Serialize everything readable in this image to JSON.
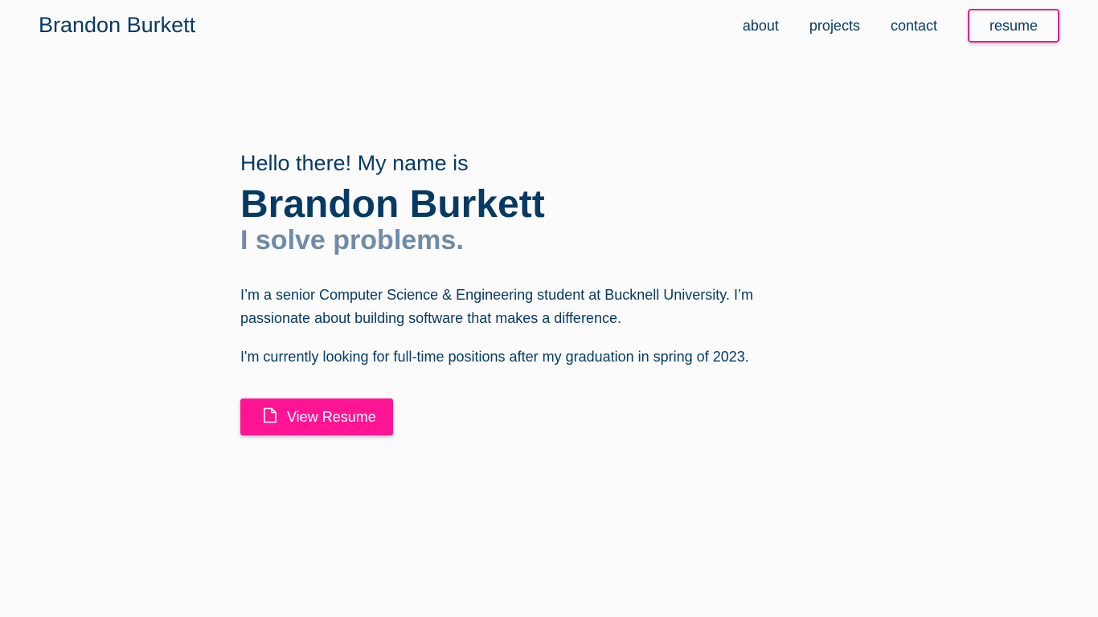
{
  "header": {
    "brand": "Brandon Burkett",
    "nav": [
      "about",
      "projects",
      "contact"
    ],
    "resume_label": "resume"
  },
  "hero": {
    "greeting": "Hello there! My name is",
    "name": "Brandon Burkett",
    "tagline": "I solve problems.",
    "paragraphs": [
      "I’m a senior Computer Science & Engineering student at Bucknell University. I’m passionate about building software that makes a difference.",
      "I'm currently looking for full-time positions after my graduation in spring of 2023."
    ],
    "cta_label": "View Resume",
    "cta_icon": "file-icon"
  },
  "colors": {
    "primary": "#063a63",
    "accent": "#ff1493",
    "muted": "#6f8ba6",
    "background": "#fbfbfc"
  }
}
